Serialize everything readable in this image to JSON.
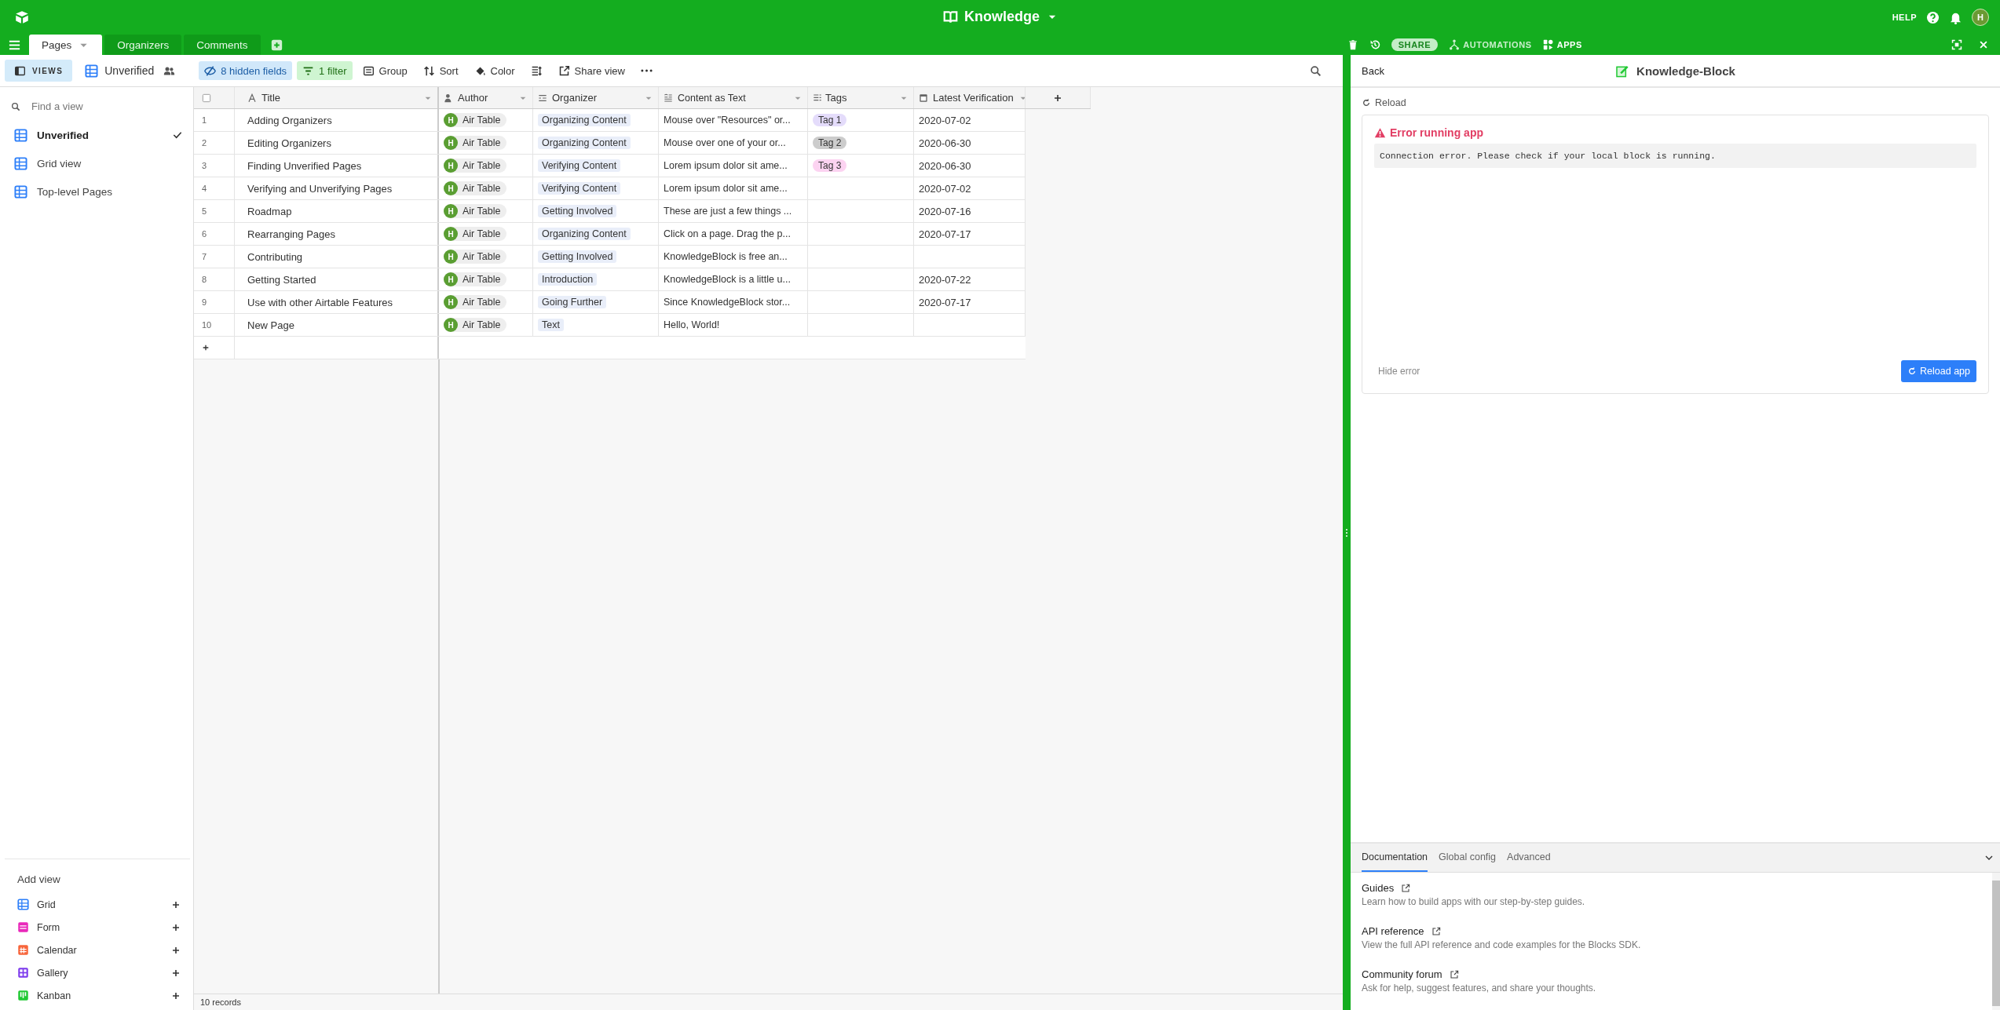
{
  "app_bar": {
    "title": "Knowledge",
    "help": "HELP",
    "avatar": "H"
  },
  "tabs": [
    {
      "label": "Pages",
      "selected": true
    },
    {
      "label": "Organizers",
      "selected": false
    },
    {
      "label": "Comments",
      "selected": false
    }
  ],
  "base_actions": [
    {
      "label": "SHARE",
      "kind": "pill"
    },
    {
      "label": "AUTOMATIONS",
      "kind": "automations"
    },
    {
      "label": "APPS",
      "kind": "apps"
    }
  ],
  "toolbar": {
    "views": "VIEWS",
    "view_name": "Unverified",
    "buttons": [
      {
        "label": "8 hidden fields",
        "kind": "hidden"
      },
      {
        "label": "1 filter",
        "kind": "filter"
      },
      {
        "label": "Group",
        "kind": "group"
      },
      {
        "label": "Sort",
        "kind": "sort"
      },
      {
        "label": "Color",
        "kind": "color"
      },
      {
        "kind": "rowheight"
      },
      {
        "label": "Share view",
        "kind": "share"
      },
      {
        "kind": "more"
      }
    ]
  },
  "sidebar": {
    "search": {
      "placeholder": "Find a view"
    },
    "views": [
      {
        "label": "Unverified",
        "selected": true
      },
      {
        "label": "Grid view",
        "selected": false
      },
      {
        "label": "Top-level Pages",
        "selected": false
      }
    ],
    "add_view": {
      "title": "Add view",
      "items": [
        {
          "label": "Grid",
          "color": "#2d7ff9"
        },
        {
          "label": "Form",
          "color": "#e929ba"
        },
        {
          "label": "Calendar",
          "color": "#f7653b"
        },
        {
          "label": "Gallery",
          "color": "#7c39ed"
        },
        {
          "label": "Kanban",
          "color": "#20c933"
        }
      ]
    }
  },
  "table": {
    "select_all": {
      "checked": false
    },
    "columns": [
      {
        "label": "Title",
        "kind": "text"
      },
      {
        "label": "Author",
        "kind": "user"
      },
      {
        "label": "Organizer",
        "kind": "link"
      },
      {
        "label": "Content as Text",
        "kind": "longtext"
      },
      {
        "label": "Tags",
        "kind": "multi"
      },
      {
        "label": "Latest Verification",
        "kind": "date"
      }
    ],
    "rows": [
      {
        "num": "1",
        "title": "Adding Organizers",
        "author": {
          "name": "Air Table",
          "initial": "H"
        },
        "organizer": "Organizing Content",
        "content": "Mouse over \"Resources\" or...",
        "tags": [
          {
            "label": "Tag 1",
            "color": "#e4dcfb"
          }
        ],
        "verified": "2020-07-02"
      },
      {
        "num": "2",
        "title": "Editing Organizers",
        "author": {
          "name": "Air Table",
          "initial": "H"
        },
        "organizer": "Organizing Content",
        "content": "Mouse over one of your or...",
        "tags": [
          {
            "label": "Tag 2",
            "color": "#cccccc"
          }
        ],
        "verified": "2020-06-30"
      },
      {
        "num": "3",
        "title": "Finding Unverified Pages",
        "author": {
          "name": "Air Table",
          "initial": "H"
        },
        "organizer": "Verifying Content",
        "content": "Lorem ipsum dolor sit ame...",
        "tags": [
          {
            "label": "Tag 3",
            "color": "#fcd3f1"
          }
        ],
        "verified": "2020-06-30"
      },
      {
        "num": "4",
        "title": "Verifying and Unverifying Pages",
        "author": {
          "name": "Air Table",
          "initial": "H"
        },
        "organizer": "Verifying Content",
        "content": "Lorem ipsum dolor sit ame...",
        "tags": [],
        "verified": "2020-07-02"
      },
      {
        "num": "5",
        "title": "Roadmap",
        "author": {
          "name": "Air Table",
          "initial": "H"
        },
        "organizer": "Getting Involved",
        "content": "These are just a few things ...",
        "tags": [],
        "verified": "2020-07-16"
      },
      {
        "num": "6",
        "title": "Rearranging Pages",
        "author": {
          "name": "Air Table",
          "initial": "H"
        },
        "organizer": "Organizing Content",
        "content": "Click on a page. Drag the p...",
        "tags": [],
        "verified": "2020-07-17"
      },
      {
        "num": "7",
        "title": "Contributing",
        "author": {
          "name": "Air Table",
          "initial": "H"
        },
        "organizer": "Getting Involved",
        "content": "KnowledgeBlock is free an...",
        "tags": [],
        "verified": ""
      },
      {
        "num": "8",
        "title": "Getting Started",
        "author": {
          "name": "Air Table",
          "initial": "H"
        },
        "organizer": "Introduction",
        "content": "KnowledgeBlock is a little u...",
        "tags": [],
        "verified": "2020-07-22"
      },
      {
        "num": "9",
        "title": "Use with other Airtable Features",
        "author": {
          "name": "Air Table",
          "initial": "H"
        },
        "organizer": "Going Further",
        "content": "Since KnowledgeBlock stor...",
        "tags": [],
        "verified": "2020-07-17"
      },
      {
        "num": "10",
        "title": "New Page",
        "author": {
          "name": "Air Table",
          "initial": "H"
        },
        "organizer": "Text",
        "content": "Hello, World!",
        "tags": [],
        "verified": ""
      }
    ],
    "footer": "10 records"
  },
  "panel": {
    "back": "Back",
    "title": "Knowledge-Block",
    "reload": "Reload",
    "error": {
      "title": "Error running app",
      "message": "Connection error. Please check if your local block is running.",
      "hide": "Hide error",
      "button": "Reload app"
    },
    "docs": {
      "tabs": [
        {
          "label": "Documentation",
          "selected": true
        },
        {
          "label": "Global config",
          "selected": false
        },
        {
          "label": "Advanced",
          "selected": false
        }
      ],
      "links": [
        {
          "title": "Guides",
          "description": "Learn how to build apps with our step-by-step guides."
        },
        {
          "title": "API reference",
          "description": "View the full API reference and code examples for the Blocks SDK."
        },
        {
          "title": "Community forum",
          "description": "Ask for help, suggest features, and share your thoughts."
        }
      ]
    }
  }
}
